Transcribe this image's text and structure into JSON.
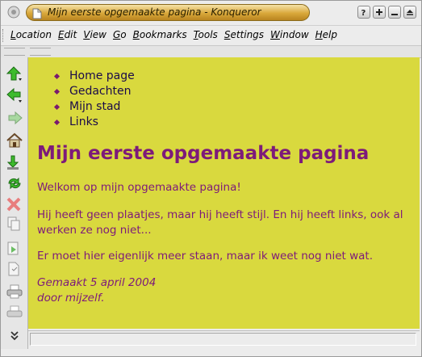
{
  "window": {
    "title": "Mijn eerste opgemaakte pagina - Konqueror"
  },
  "menubar": {
    "items": [
      {
        "u": "L",
        "rest": "ocation"
      },
      {
        "u": "E",
        "rest": "dit"
      },
      {
        "u": "V",
        "rest": "iew"
      },
      {
        "u": "G",
        "rest": "o"
      },
      {
        "u": "B",
        "rest": "ookmarks"
      },
      {
        "u": "T",
        "rest": "ools"
      },
      {
        "u": "S",
        "rest": "ettings"
      },
      {
        "u": "W",
        "rest": "indow"
      },
      {
        "u": "H",
        "rest": "elp"
      }
    ]
  },
  "toolbar_icons": [
    "up-arrow-icon",
    "back-arrow-icon",
    "forward-arrow-icon",
    "home-icon",
    "save-icon",
    "reload-icon",
    "stop-icon",
    "copy-icon",
    "paste-icon",
    "bookmark-page-icon",
    "print-icon",
    "print-frame-icon",
    "more-chevron-icon"
  ],
  "page": {
    "nav": [
      "Home page",
      "Gedachten",
      "Mijn stad",
      "Links"
    ],
    "heading": "Mijn eerste opgemaakte pagina",
    "p1": "Welkom op mijn opgemaakte pagina!",
    "p2": "Hij heeft geen plaatjes, maar hij heeft stijl. En hij heeft links, ook al werken ze nog niet...",
    "p3": "Er moet hier eigenlijk meer staan, maar ik weet nog niet wat.",
    "sig_line1": "Gemaakt 5 april 2004",
    "sig_line2": "door mijzelf."
  },
  "status": {
    "text": ""
  },
  "colors": {
    "page_bg": "#d9d93e",
    "text": "#7d1a7a",
    "links": "#1a0a4a",
    "title_pill": "#d9a83a"
  }
}
